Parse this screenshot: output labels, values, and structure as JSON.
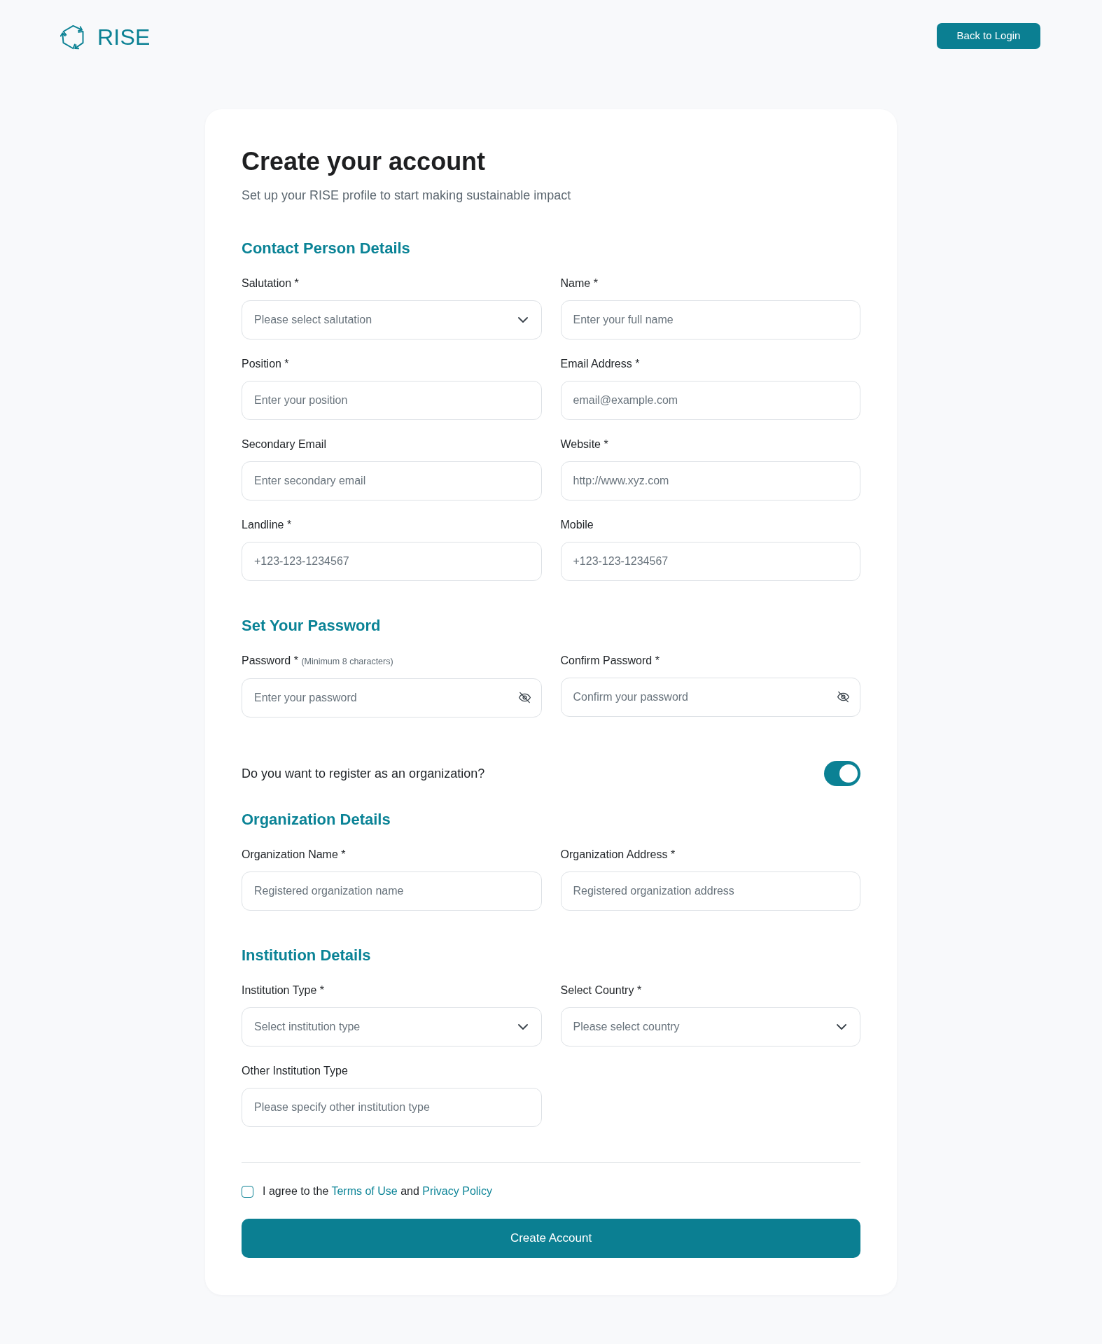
{
  "header": {
    "logo_text": "RISE",
    "back_button": "Back to Login"
  },
  "form": {
    "title": "Create your account",
    "subtitle": "Set up your RISE profile to start making sustainable impact",
    "blocks": [
      {
        "kind": "fields",
        "title": "Contact Person Details",
        "fields": [
          {
            "kind": "select",
            "label": "Salutation *",
            "placeholder": "Please select salutation"
          },
          {
            "kind": "text",
            "label": "Name *",
            "placeholder": "Enter your full name"
          },
          {
            "kind": "text",
            "label": "Position *",
            "placeholder": "Enter your position"
          },
          {
            "kind": "text",
            "label": "Email Address *",
            "placeholder": "email@example.com"
          },
          {
            "kind": "text",
            "label": "Secondary Email",
            "placeholder": "Enter secondary email"
          },
          {
            "kind": "text",
            "label": "Website *",
            "placeholder": "http://www.xyz.com"
          },
          {
            "kind": "text",
            "label": "Landline *",
            "placeholder": "+123-123-1234567"
          },
          {
            "kind": "text",
            "label": "Mobile",
            "placeholder": "+123-123-1234567"
          }
        ]
      },
      {
        "kind": "fields",
        "title": "Set Your Password",
        "fields": [
          {
            "kind": "password",
            "label": "Password *",
            "hint": "(Minimum 8 characters)",
            "placeholder": "Enter your password"
          },
          {
            "kind": "password",
            "label": "Confirm Password *",
            "placeholder": "Confirm your password"
          }
        ]
      },
      {
        "kind": "toggle",
        "label": "Do you want to register as an organization?",
        "on": true
      },
      {
        "kind": "fields",
        "title": "Organization Details",
        "fields": [
          {
            "kind": "text",
            "label": "Organization Name *",
            "placeholder": "Registered organization name"
          },
          {
            "kind": "text",
            "label": "Organization Address *",
            "placeholder": "Registered organization address"
          }
        ]
      },
      {
        "kind": "fields",
        "title": "Institution Details",
        "fields": [
          {
            "kind": "select",
            "label": "Institution Type *",
            "placeholder": "Select institution type"
          },
          {
            "kind": "select",
            "label": "Select Country *",
            "placeholder": "Please select country"
          },
          {
            "kind": "text",
            "label": "Other Institution Type",
            "placeholder": "Please specify other institution type"
          }
        ]
      }
    ],
    "terms": {
      "checked": false,
      "parts": [
        {
          "kind": "text",
          "text": "I agree to the"
        },
        {
          "kind": "link",
          "text": "Terms of Use"
        },
        {
          "kind": "text",
          "text": "and"
        },
        {
          "kind": "link",
          "text": "Privacy Policy"
        }
      ]
    },
    "submit_button": "Create Account"
  }
}
